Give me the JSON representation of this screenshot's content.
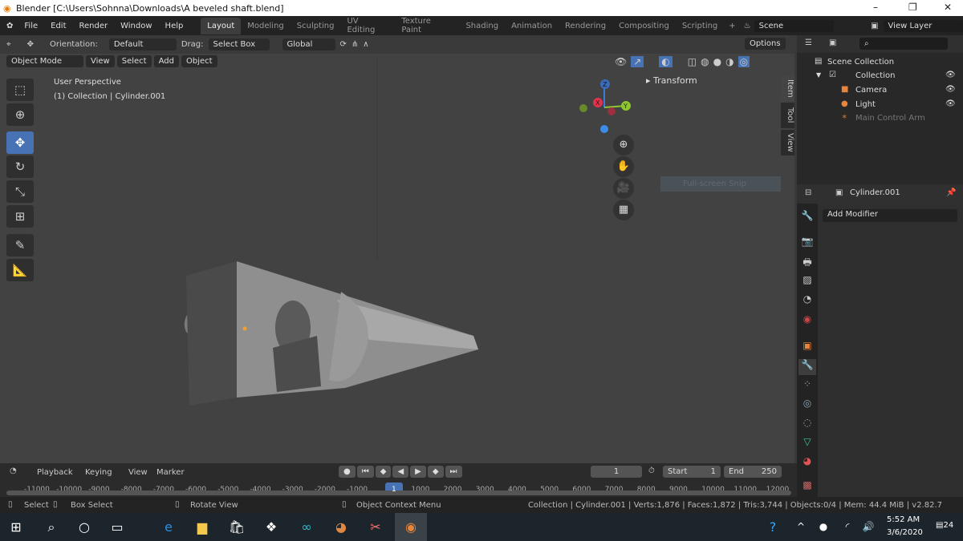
{
  "window": {
    "title": "Blender [C:\\Users\\Sohnna\\Downloads\\A beveled shaft.blend]",
    "min": "–",
    "max": "❐",
    "close": "✕"
  },
  "menus": [
    "File",
    "Edit",
    "Render",
    "Window",
    "Help"
  ],
  "workspaces": [
    "Layout",
    "Modeling",
    "Sculpting",
    "UV Editing",
    "Texture Paint",
    "Shading",
    "Animation",
    "Rendering",
    "Compositing",
    "Scripting"
  ],
  "active_workspace": "Layout",
  "scene": "Scene",
  "view_layer": "View Layer",
  "tool_header": {
    "orientation_label": "Orientation:",
    "orientation": "Default",
    "drag_label": "Drag:",
    "drag": "Select Box",
    "transform": "Global",
    "options": "Options"
  },
  "viewport_header": {
    "mode": "Object Mode",
    "menus": [
      "View",
      "Select",
      "Add",
      "Object"
    ]
  },
  "viewport": {
    "perspective": "User Perspective",
    "context": "(1) Collection | Cylinder.001",
    "transform_panel": "Transform",
    "hint": "Full-screen Snip",
    "axes": {
      "x": "X",
      "y": "Y",
      "z": "Z"
    },
    "side_tabs": [
      "Item",
      "Tool",
      "View"
    ]
  },
  "outliner": {
    "root": "Scene Collection",
    "items": [
      {
        "name": "Collection"
      },
      {
        "name": "Camera"
      },
      {
        "name": "Light"
      },
      {
        "name": "Main Control Arm"
      }
    ]
  },
  "properties": {
    "object": "Cylinder.001",
    "add_modifier": "Add Modifier"
  },
  "timeline": {
    "menus": [
      "Playback",
      "Keying",
      "View",
      "Marker"
    ],
    "current_frame": "1",
    "start_label": "Start",
    "start": "1",
    "end_label": "End",
    "end": "250",
    "ticks": [
      "-11000",
      "-10000",
      "-9000",
      "-8000",
      "-7000",
      "-6000",
      "-5000",
      "-4000",
      "-3000",
      "-2000",
      "-1000",
      "1",
      "1000",
      "2000",
      "3000",
      "4000",
      "5000",
      "6000",
      "7000",
      "8000",
      "9000",
      "10000",
      "11000",
      "12000"
    ]
  },
  "statusbar": {
    "select": "Select",
    "box_select": "Box Select",
    "rotate": "Rotate View",
    "context_menu": "Object Context Menu",
    "stats": "Collection | Cylinder.001 | Verts:1,876 | Faces:1,872 | Tris:3,744 | Objects:0/4 | Mem: 44.4 MiB | v2.82.7"
  },
  "taskbar": {
    "time": "5:52 AM",
    "date": "3/6/2020",
    "notifications": "24"
  },
  "colors": {
    "accent": "#4772b3",
    "viewport": "#424242"
  }
}
